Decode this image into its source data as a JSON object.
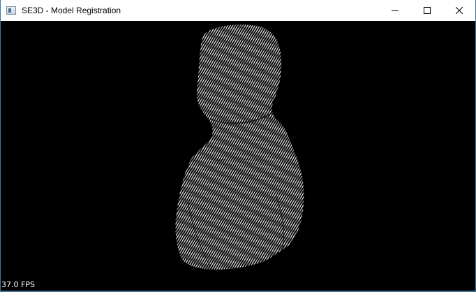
{
  "window": {
    "title": "SE3D - Model Registration",
    "icon": "app-window-icon",
    "controls": {
      "minimize_icon": "minimize-icon",
      "maximize_icon": "maximize-icon",
      "close_icon": "close-icon"
    }
  },
  "viewport": {
    "background": "#000000",
    "point_color": "#ffffff",
    "fps_text": "37.0 FPS"
  }
}
